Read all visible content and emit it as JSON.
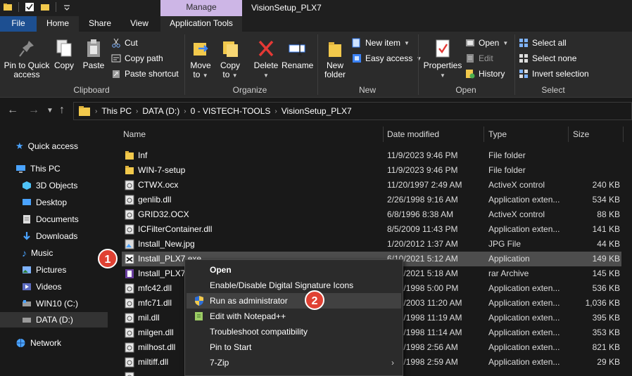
{
  "titlebar": {
    "manage_label": "Manage",
    "window_title": "VisionSetup_PLX7"
  },
  "tabs": [
    "File",
    "Home",
    "Share",
    "View",
    "Application Tools"
  ],
  "ribbon": {
    "clipboard": {
      "pin_label_1": "Pin to Quick",
      "pin_label_2": "access",
      "copy_label": "Copy",
      "paste_label": "Paste",
      "cut_label": "Cut",
      "copy_path_label": "Copy path",
      "paste_shortcut_label": "Paste shortcut",
      "group_label": "Clipboard"
    },
    "organize": {
      "move_to_1": "Move",
      "move_to_2": "to",
      "copy_to_1": "Copy",
      "copy_to_2": "to",
      "delete_label": "Delete",
      "rename_label": "Rename",
      "group_label": "Organize"
    },
    "new": {
      "new_folder_1": "New",
      "new_folder_2": "folder",
      "new_item_label": "New item",
      "easy_access_label": "Easy access",
      "group_label": "New"
    },
    "open": {
      "properties_label": "Properties",
      "open_label": "Open",
      "edit_label": "Edit",
      "history_label": "History",
      "group_label": "Open"
    },
    "select": {
      "select_all_label": "Select all",
      "select_none_label": "Select none",
      "invert_label": "Invert selection",
      "group_label": "Select"
    }
  },
  "address": {
    "crumbs": [
      "This PC",
      "DATA (D:)",
      "0 - VISTECH-TOOLS",
      "VisionSetup_PLX7"
    ]
  },
  "sidebar": {
    "quick_access": "Quick access",
    "this_pc": "This PC",
    "objects_3d": "3D Objects",
    "desktop": "Desktop",
    "documents": "Documents",
    "downloads": "Downloads",
    "music": "Music",
    "pictures": "Pictures",
    "videos": "Videos",
    "win10": "WIN10 (C:)",
    "data": "DATA (D:)",
    "network": "Network"
  },
  "columns": {
    "name": "Name",
    "modified": "Date modified",
    "type": "Type",
    "size": "Size"
  },
  "files": [
    {
      "name": "Inf",
      "modified": "11/9/2023 9:46 PM",
      "type": "File folder",
      "size": "",
      "icon": "folder-icon"
    },
    {
      "name": "WIN-7-setup",
      "modified": "11/9/2023 9:46 PM",
      "type": "File folder",
      "size": "",
      "icon": "folder-icon"
    },
    {
      "name": "CTWX.ocx",
      "modified": "11/20/1997 2:49 AM",
      "type": "ActiveX control",
      "size": "240 KB",
      "icon": "file-icon"
    },
    {
      "name": "genlib.dll",
      "modified": "2/26/1998 9:16 AM",
      "type": "Application exten...",
      "size": "534 KB",
      "icon": "file-icon"
    },
    {
      "name": "GRID32.OCX",
      "modified": "6/8/1996 8:38 AM",
      "type": "ActiveX control",
      "size": "88 KB",
      "icon": "file-icon"
    },
    {
      "name": "ICFilterContainer.dll",
      "modified": "8/5/2009 11:43 PM",
      "type": "Application exten...",
      "size": "141 KB",
      "icon": "file-icon"
    },
    {
      "name": "Install_New.jpg",
      "modified": "1/20/2012 1:37 AM",
      "type": "JPG File",
      "size": "44 KB",
      "icon": "image-icon"
    },
    {
      "name": "Install_PLX7.exe",
      "modified": "6/10/2021 5:12 AM",
      "type": "Application",
      "size": "149 KB",
      "icon": "exe-icon"
    },
    {
      "name": "Install_PLX7.rar",
      "modified": "6/10/2021 5:18 AM",
      "type": "rar Archive",
      "size": "145 KB",
      "icon": "rar-icon"
    },
    {
      "name": "mfc42.dll",
      "modified": "6/12/1998 5:00 PM",
      "type": "Application exten...",
      "size": "536 KB",
      "icon": "file-icon"
    },
    {
      "name": "mfc71.dll",
      "modified": "3/18/2003 11:20 AM",
      "type": "Application exten...",
      "size": "1,036 KB",
      "icon": "file-icon"
    },
    {
      "name": "mil.dll",
      "modified": "6/12/1998 11:19 AM",
      "type": "Application exten...",
      "size": "395 KB",
      "icon": "file-icon"
    },
    {
      "name": "milgen.dll",
      "modified": "6/12/1998 11:14 AM",
      "type": "Application exten...",
      "size": "353 KB",
      "icon": "file-icon"
    },
    {
      "name": "milhost.dll",
      "modified": "6/12/1998 2:56 AM",
      "type": "Application exten...",
      "size": "821 KB",
      "icon": "file-icon"
    },
    {
      "name": "miltiff.dll",
      "modified": "6/12/1998 2:59 AM",
      "type": "Application exten...",
      "size": "29 KB",
      "icon": "file-icon"
    },
    {
      "name": "",
      "modified": "",
      "type": "",
      "size": "",
      "icon": "file-icon"
    }
  ],
  "context_menu": {
    "items": [
      "Open",
      "Enable/Disable Digital Signature Icons",
      "Run as administrator",
      "Edit with Notepad++",
      "Troubleshoot compatibility",
      "Pin to Start",
      "7-Zip",
      ""
    ]
  },
  "badges": {
    "step1": "1",
    "step2": "2"
  },
  "colors": {
    "accent_file_tab": "#1d4f91",
    "manage_tab": "#cdb6e6",
    "badge": "#e04133",
    "folder": "#f2c94c"
  }
}
